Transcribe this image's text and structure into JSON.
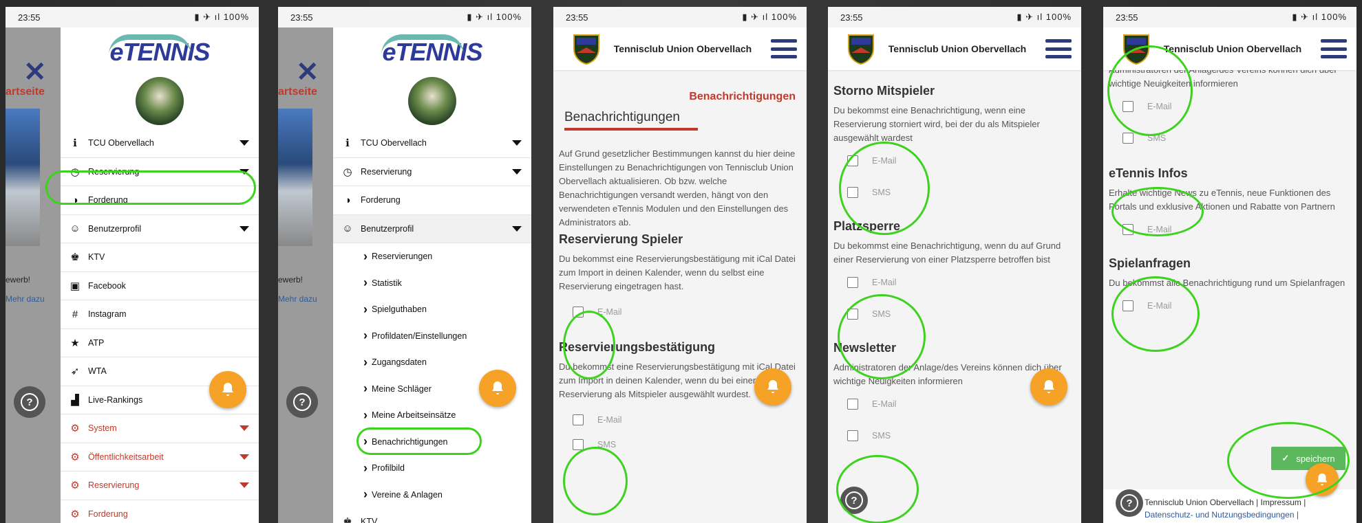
{
  "status": {
    "time": "23:55",
    "battery": "100%"
  },
  "club": {
    "title": "Tennisclub Union Obervellach"
  },
  "brand": {
    "logo": "eTENNIS",
    "accent": "#f5a227",
    "primary": "#2e3a7a",
    "red": "#c0392b",
    "highlight": "#3cd21e"
  },
  "behind": {
    "startseite": "artseite",
    "werb": "ewerb!",
    "mehr": "Mehr dazu"
  },
  "menu1": {
    "items": [
      {
        "icon": "info-icon",
        "label": "TCU Obervellach",
        "caret": true
      },
      {
        "icon": "clock-icon",
        "label": "Reservierung",
        "caret": true
      },
      {
        "icon": "ball-icon",
        "label": "Forderung",
        "caret": false
      },
      {
        "icon": "user-icon",
        "label": "Benutzerprofil",
        "caret": true
      },
      {
        "icon": "trophy-icon",
        "label": "KTV",
        "caret": false
      },
      {
        "icon": "facebook-icon",
        "label": "Facebook",
        "caret": false
      },
      {
        "icon": "hash-icon",
        "label": "Instagram",
        "caret": false
      },
      {
        "icon": "star-icon",
        "label": "ATP",
        "caret": false
      },
      {
        "icon": "rocket-icon",
        "label": "WTA",
        "caret": false
      },
      {
        "icon": "podium-icon",
        "label": "Live-Rankings",
        "caret": false
      },
      {
        "icon": "gears-icon",
        "label": "System",
        "caret": true,
        "red": true
      },
      {
        "icon": "gears-icon",
        "label": "Öffentlichkeitsarbeit",
        "caret": true,
        "red": true
      },
      {
        "icon": "gears-icon",
        "label": "Reservierung",
        "caret": true,
        "red": true
      },
      {
        "icon": "gears-icon",
        "label": "Forderung",
        "caret": false,
        "red": true
      }
    ]
  },
  "menu2": {
    "top": [
      {
        "label": "TCU Obervellach"
      },
      {
        "label": "Reservierung"
      },
      {
        "label": "Forderung"
      },
      {
        "label": "Benutzerprofil"
      }
    ],
    "sub": [
      "Reservierungen",
      "Statistik",
      "Spielguthaben",
      "Profildaten/Einstellungen",
      "Zugangsdaten",
      "Meine Schläger",
      "Meine Arbeitseinsätze",
      "Benachrichtigungen",
      "Profilbild",
      "Vereine & Anlagen"
    ],
    "last": "KTV"
  },
  "notif": {
    "breadcrumb": "Benachrichtigungen",
    "title": "Benachrichtigungen",
    "intro": "Auf Grund gesetzlicher Bestimmungen kannst du hier deine Einstellungen zu Benachrichtigungen von Tennisclub Union Obervellach aktualisieren. Ob bzw. welche Benachrichtigungen versandt werden, hängt von den verwendeten eTennis Modulen und den Einstellungen des Administrators ab.",
    "s1": {
      "title": "Reservierung Spieler",
      "text": "Du bekommst eine Reservierungsbestätigung mit iCal Datei zum Import in deinen Kalender, wenn du selbst eine Reservierung eingetragen hast.",
      "opt": "E-Mail"
    },
    "s2": {
      "title": "Reservierungsbestätigung",
      "text": "Du bekommst eine Reservierungsbestätigung mit iCal Datei zum Import in deinen Kalender, wenn du bei einer Reservierung als Mitspieler ausgewählt wurdest.",
      "opt1": "E-Mail",
      "opt2": "SMS"
    },
    "s3": {
      "title": "Storno Mitspieler",
      "text": "Du bekommst eine Benachrichtigung, wenn eine Reservierung storniert wird, bei der du als Mitspieler ausgewählt wardest",
      "opt1": "E-Mail",
      "opt2": "SMS"
    },
    "s4": {
      "title": "Platzsperre",
      "text": "Du bekommst eine Benachrichtigung, wenn du auf Grund einer Reservierung von einer Platzsperre betroffen bist",
      "opt1": "E-Mail",
      "opt2": "SMS"
    },
    "s5": {
      "title": "Newsletter",
      "text": "Administratoren der Anlage/des Vereins können dich über wichtige Neuigkeiten informieren",
      "opt1": "E-Mail",
      "opt2": "SMS"
    },
    "s5top": "Administratoren der Anlage/des Vereins können dich über wichtige Neuigkeiten informieren",
    "s6": {
      "title": "eTennis Infos",
      "text": "Erhalte wichtige News zu eTennis, neue Funktionen des Portals und exklusive Aktionen und Rabatte von Partnern",
      "opt": "E-Mail"
    },
    "s7": {
      "title": "Spielanfragen",
      "text": "Du bekommst alle Benachrichtigung rund um Spielanfragen",
      "opt": "E-Mail"
    },
    "save": "speichern",
    "footer1": "Tennisclub Union Obervellach | Impressum |",
    "footer2": "Datenschutz- und Nutzungsbedingungen |"
  }
}
